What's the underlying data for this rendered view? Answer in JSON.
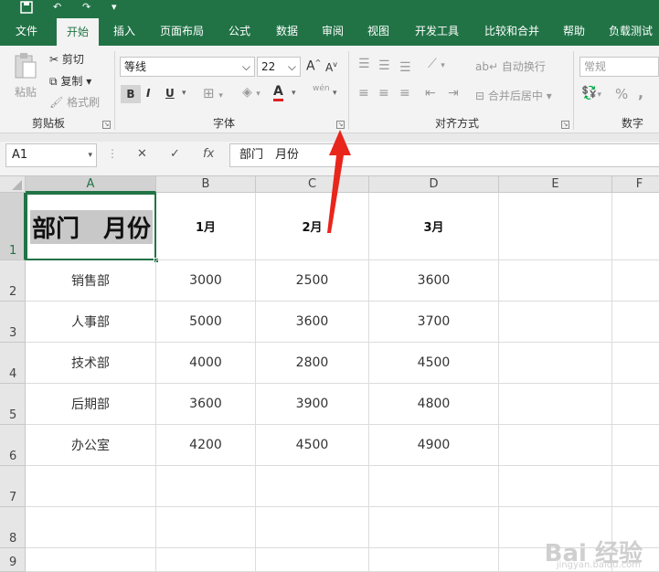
{
  "quick_access": {
    "save_icon": "save-icon",
    "undo_icon": "undo-icon",
    "redo_icon": "redo-icon",
    "customize_icon": "chevron-down-icon"
  },
  "tabs": [
    {
      "label": "文件"
    },
    {
      "label": "开始"
    },
    {
      "label": "插入"
    },
    {
      "label": "页面布局"
    },
    {
      "label": "公式"
    },
    {
      "label": "数据"
    },
    {
      "label": "审阅"
    },
    {
      "label": "视图"
    },
    {
      "label": "开发工具"
    },
    {
      "label": "比较和合并"
    },
    {
      "label": "帮助"
    },
    {
      "label": "负载测试"
    }
  ],
  "ribbon": {
    "clipboard": {
      "paste": "粘贴",
      "cut": "剪切",
      "copy": "复制",
      "format_painter": "格式刷",
      "group_label": "剪贴板"
    },
    "font": {
      "font_name": "等线",
      "font_size": "22",
      "bold": "B",
      "italic": "I",
      "underline": "U",
      "font_color": "A",
      "phonetic": "wén",
      "group_label": "字体"
    },
    "alignment": {
      "wrap_text": "自动换行",
      "merge_center": "合并后居中",
      "group_label": "对齐方式"
    },
    "number": {
      "format": "常规",
      "percent": "%",
      "comma": ",",
      "group_label": "数字"
    }
  },
  "formula_bar": {
    "name_box": "A1",
    "cancel": "✕",
    "enter": "✓",
    "fx": "fx",
    "content": "部门　月份"
  },
  "sheet": {
    "columns": [
      "A",
      "B",
      "C",
      "D",
      "E",
      "F"
    ],
    "rows": [
      "1",
      "2",
      "3",
      "4",
      "5",
      "6",
      "7",
      "8",
      "9"
    ],
    "header_row": {
      "a": "部门　月份",
      "b": "1月",
      "c": "2月",
      "d": "3月"
    },
    "data": [
      {
        "dept": "销售部",
        "m1": "3000",
        "m2": "2500",
        "m3": "3600"
      },
      {
        "dept": "人事部",
        "m1": "5000",
        "m2": "3600",
        "m3": "3700"
      },
      {
        "dept": "技术部",
        "m1": "4000",
        "m2": "2800",
        "m3": "4500"
      },
      {
        "dept": "后期部",
        "m1": "3600",
        "m2": "3900",
        "m3": "4800"
      },
      {
        "dept": "办公室",
        "m1": "4200",
        "m2": "4500",
        "m3": "4900"
      }
    ]
  },
  "watermark": {
    "main": "Bai 经验",
    "sub": "jingyan.baidu.com"
  },
  "colors": {
    "accent": "#217346",
    "arrow": "#e8261c"
  }
}
